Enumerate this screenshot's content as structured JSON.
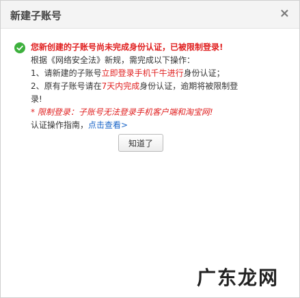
{
  "dialog": {
    "title": "新建子账号",
    "close_label": "×"
  },
  "message": {
    "headline": "您新创建的子账号尚未完成身份认证，已被限制登录!",
    "line2": "根据《网络安全法》新规，需完成以下操作：",
    "line3_prefix": "1、请新建的子账号",
    "line3_highlight": "立即登录手机千牛进行",
    "line3_suffix": "身份认证；",
    "line4_prefix": "2、原有子账号请在",
    "line4_highlight": "7天内完成",
    "line4_suffix": "身份认证，逾期将被限制登",
    "line5": "录!",
    "note": "* 限制登录：子账号无法登录手机客户端和淘宝网!",
    "guide_prefix": "认证操作指南，",
    "guide_link": "点击查看>"
  },
  "button": {
    "ok_label": "知道了"
  },
  "watermark": {
    "text": "广东龙网"
  },
  "colors": {
    "accent_red": "#e02020",
    "link_blue": "#1a66c8",
    "success_green": "#3db03d"
  },
  "icons": {
    "status": "check-circle-icon",
    "close": "close-icon"
  }
}
